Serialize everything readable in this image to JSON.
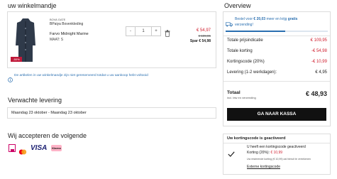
{
  "cart": {
    "title": "uw winkelmandje",
    "item": {
      "brand": "BOVA GATE",
      "subtitle": "BPaiya Bovenkleding",
      "name": "Farvo Midnight Marine",
      "size": "MAAT: S",
      "badge": "-50%",
      "quantity": "1",
      "minus": "-",
      "plus": "+",
      "price": "€ 54,97",
      "old_price": "€ 109,95",
      "save": "Spar € 54,98"
    },
    "notice": "De artikelen in uw winkelmandje zijn niet gereserveerd totdat u uw aankoop hebt voltooid",
    "colors": {
      "coat": "#2f3a4a",
      "badge": "#c0193a"
    }
  },
  "delivery": {
    "title": "Verwachte levering",
    "dates": "Maandag 23 oktober - Maandag 23 oktober"
  },
  "payments": {
    "title": "Wij accepteren de volgende",
    "methods": [
      "iDEAL",
      "Mastercard",
      "VISA",
      "Klarna"
    ]
  },
  "overview": {
    "title": "Overview",
    "promo_prefix": "Bestel voor ",
    "promo_amount": "€ 20,03",
    "promo_mid": " meer en krijg ",
    "promo_bold": "gratis",
    "promo_end": "verzending!",
    "progress": 0.58,
    "rows": [
      {
        "label": "Totale prijsindicatie",
        "value": "€ 109,95",
        "red": true
      },
      {
        "label": "Totale korting",
        "value": "-€ 54,98",
        "red": true
      },
      {
        "label": "Kortingscode (20%)",
        "value": "-€ 10,99",
        "red": true
      },
      {
        "label": "Levering (1-2 werkdagen):",
        "value": "€ 4,95",
        "red": false
      }
    ],
    "total_label": "Totaal",
    "total_sub": "incl. btw en verzending",
    "total_value": "€ 48,93",
    "checkout": "GA NAAR KASSA"
  },
  "discount": {
    "title": "Uw kortingscode is geactiveerd",
    "line1": "U heeft een kortingscode geactiveerd",
    "line2_prefix": "Korting (20%): ",
    "line2_amount": "€ 10,99",
    "small": "Uw resterende korting (€ 10,99) zal hieruit te verrekenen",
    "link": "Externe kortingscode"
  }
}
